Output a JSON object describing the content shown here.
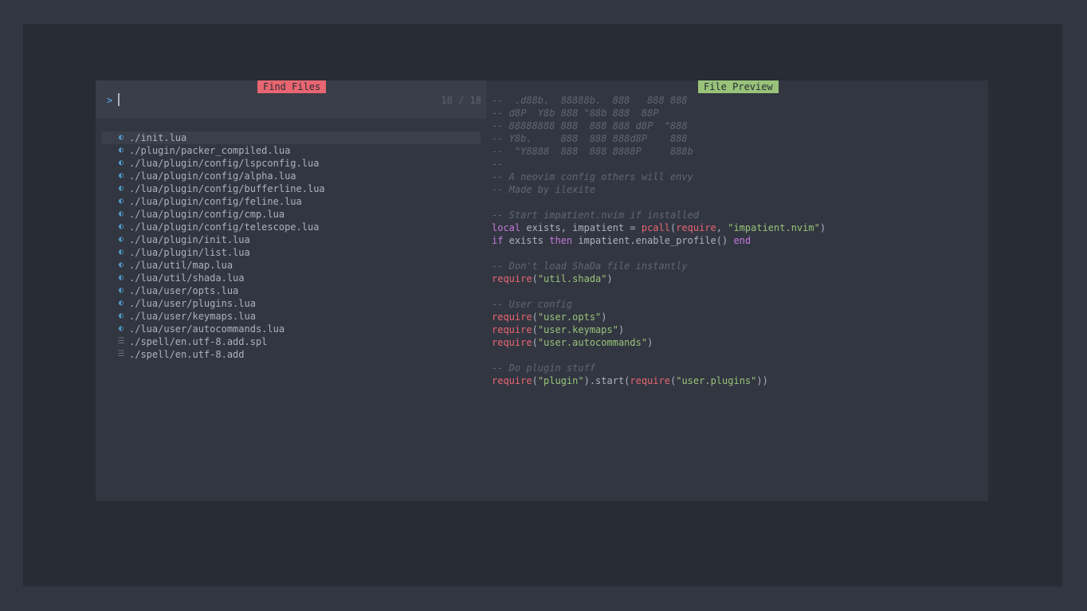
{
  "picker": {
    "results_title": "Find Files",
    "preview_title": "File Preview",
    "prompt_prefix": ">",
    "query": "",
    "counter": "18 / 18"
  },
  "colors": {
    "find_title_bg": "#e86671",
    "preview_title_bg": "#98c379",
    "lua_icon": "#51a0cf"
  },
  "results": [
    {
      "icon": "lua-icon",
      "path": "./init.lua",
      "selected": true
    },
    {
      "icon": "lua-icon",
      "path": "./plugin/packer_compiled.lua"
    },
    {
      "icon": "lua-icon",
      "path": "./lua/plugin/config/lspconfig.lua"
    },
    {
      "icon": "lua-icon",
      "path": "./lua/plugin/config/alpha.lua"
    },
    {
      "icon": "lua-icon",
      "path": "./lua/plugin/config/bufferline.lua"
    },
    {
      "icon": "lua-icon",
      "path": "./lua/plugin/config/feline.lua"
    },
    {
      "icon": "lua-icon",
      "path": "./lua/plugin/config/cmp.lua"
    },
    {
      "icon": "lua-icon",
      "path": "./lua/plugin/config/telescope.lua"
    },
    {
      "icon": "lua-icon",
      "path": "./lua/plugin/init.lua"
    },
    {
      "icon": "lua-icon",
      "path": "./lua/plugin/list.lua"
    },
    {
      "icon": "lua-icon",
      "path": "./lua/util/map.lua"
    },
    {
      "icon": "lua-icon",
      "path": "./lua/util/shada.lua"
    },
    {
      "icon": "lua-icon",
      "path": "./lua/user/opts.lua"
    },
    {
      "icon": "lua-icon",
      "path": "./lua/user/plugins.lua"
    },
    {
      "icon": "lua-icon",
      "path": "./lua/user/keymaps.lua"
    },
    {
      "icon": "lua-icon",
      "path": "./lua/user/autocommands.lua"
    },
    {
      "icon": "file-icon",
      "path": "./spell/en.utf-8.add.spl"
    },
    {
      "icon": "file-icon",
      "path": "./spell/en.utf-8.add"
    }
  ],
  "preview_lines": [
    [
      {
        "t": "c",
        "v": "--  .d88b.  88888b.  888   888 888"
      }
    ],
    [
      {
        "t": "c",
        "v": "-- d8P  Y8b 888 \"88b 888  88P"
      }
    ],
    [
      {
        "t": "c",
        "v": "-- 88888888 888  888 888 d8P  \"888"
      }
    ],
    [
      {
        "t": "c",
        "v": "-- Y8b.     888  888 888d8P    888"
      }
    ],
    [
      {
        "t": "c",
        "v": "--  \"Y8888  888  888 8888P     888b"
      }
    ],
    [
      {
        "t": "c",
        "v": "--"
      }
    ],
    [
      {
        "t": "c",
        "v": "-- A neovim config others will envy"
      }
    ],
    [
      {
        "t": "c",
        "v": "-- Made by ilexite"
      }
    ],
    [],
    [
      {
        "t": "c",
        "v": "-- Start impatient.nvim if installed"
      }
    ],
    [
      {
        "t": "k",
        "v": "local"
      },
      {
        "t": "p",
        "v": " exists, impatient = "
      },
      {
        "t": "f",
        "v": "pcall"
      },
      {
        "t": "p",
        "v": "("
      },
      {
        "t": "f",
        "v": "require"
      },
      {
        "t": "p",
        "v": ", "
      },
      {
        "t": "s",
        "v": "\"impatient.nvim\""
      },
      {
        "t": "p",
        "v": ")"
      }
    ],
    [
      {
        "t": "k",
        "v": "if"
      },
      {
        "t": "p",
        "v": " exists "
      },
      {
        "t": "k",
        "v": "then"
      },
      {
        "t": "p",
        "v": " impatient.enable_profile() "
      },
      {
        "t": "k",
        "v": "end"
      }
    ],
    [],
    [
      {
        "t": "c",
        "v": "-- Don't load ShaDa file instantly"
      }
    ],
    [
      {
        "t": "f",
        "v": "require"
      },
      {
        "t": "p",
        "v": "("
      },
      {
        "t": "s",
        "v": "\"util.shada\""
      },
      {
        "t": "p",
        "v": ")"
      }
    ],
    [],
    [
      {
        "t": "c",
        "v": "-- User config"
      }
    ],
    [
      {
        "t": "f",
        "v": "require"
      },
      {
        "t": "p",
        "v": "("
      },
      {
        "t": "s",
        "v": "\"user.opts\""
      },
      {
        "t": "p",
        "v": ")"
      }
    ],
    [
      {
        "t": "f",
        "v": "require"
      },
      {
        "t": "p",
        "v": "("
      },
      {
        "t": "s",
        "v": "\"user.keymaps\""
      },
      {
        "t": "p",
        "v": ")"
      }
    ],
    [
      {
        "t": "f",
        "v": "require"
      },
      {
        "t": "p",
        "v": "("
      },
      {
        "t": "s",
        "v": "\"user.autocommands\""
      },
      {
        "t": "p",
        "v": ")"
      }
    ],
    [],
    [
      {
        "t": "c",
        "v": "-- Do plugin stuff"
      }
    ],
    [
      {
        "t": "f",
        "v": "require"
      },
      {
        "t": "p",
        "v": "("
      },
      {
        "t": "s",
        "v": "\"plugin\""
      },
      {
        "t": "p",
        "v": ").start("
      },
      {
        "t": "f",
        "v": "require"
      },
      {
        "t": "p",
        "v": "("
      },
      {
        "t": "s",
        "v": "\"user.plugins\""
      },
      {
        "t": "p",
        "v": "))"
      }
    ]
  ]
}
